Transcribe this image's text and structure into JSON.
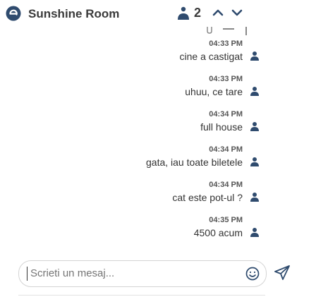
{
  "header": {
    "room_name": "Sunshine Room",
    "user_count": "2",
    "icons": [
      "app-logo-icon",
      "users-icon",
      "chevron-up-icon",
      "chevron-down-icon"
    ]
  },
  "messages": [
    {
      "time": "04:33 PM",
      "text": "cine a castigat"
    },
    {
      "time": "04:33 PM",
      "text": "uhuu, ce tare"
    },
    {
      "time": "04:34 PM",
      "text": "full house"
    },
    {
      "time": "04:34 PM",
      "text": "gata, iau toate biletele"
    },
    {
      "time": "04:34 PM",
      "text": "cat este pot-ul ?"
    },
    {
      "time": "04:35 PM",
      "text": "4500 acum"
    }
  ],
  "composer": {
    "placeholder": "Scrieti un mesaj..."
  },
  "colors": {
    "accent": "#2f4b6e",
    "text": "#333333",
    "avatar": "#2f4b6e"
  }
}
